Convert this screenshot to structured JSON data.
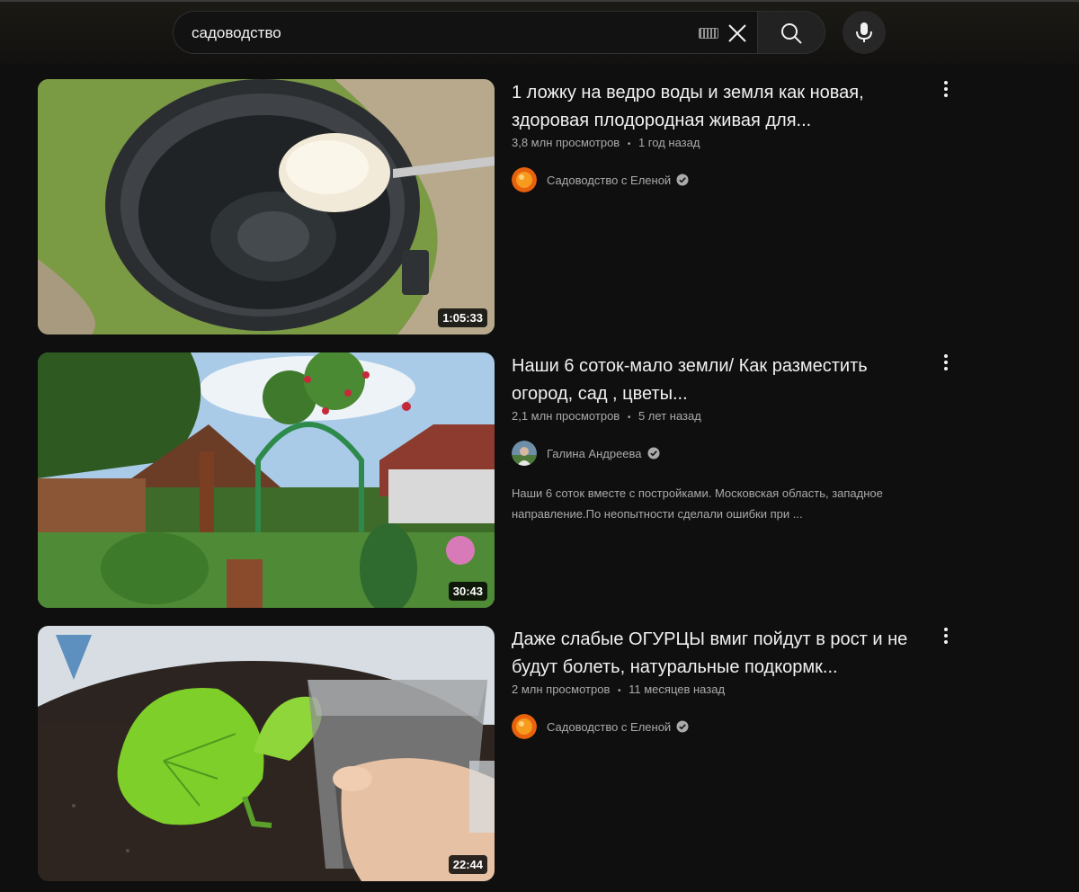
{
  "search": {
    "query": "садоводство"
  },
  "results": [
    {
      "title": "1 ложку на ведро воды и земля как новая, здоровая плодородная живая для...",
      "views": "3,8 млн просмотров",
      "age": "1 год назад",
      "channel": "Садоводство с Еленой",
      "duration": "1:05:33",
      "description": ""
    },
    {
      "title": "Наши 6 соток-мало земли/ Как разместить огород, сад , цветы...",
      "views": "2,1 млн просмотров",
      "age": "5 лет назад",
      "channel": "Галина Андреева",
      "duration": "30:43",
      "description": "Наши 6 соток вместе с постройками. Московская область, западное направление.По неопытности сделали ошибки при ..."
    },
    {
      "title": "Даже слабые ОГУРЦЫ вмиг пойдут в рост и не будут болеть, натуральные подкормк...",
      "views": "2 млн просмотров",
      "age": "11 месяцев назад",
      "channel": "Садоводство с Еленой",
      "duration": "22:44",
      "description": ""
    }
  ],
  "separator": "•",
  "icons": {
    "keyboard": "keyboard-icon",
    "clear": "close-icon",
    "search": "search-icon",
    "mic": "mic-icon",
    "more": "more-vert-icon",
    "verified": "verified-check-icon"
  }
}
